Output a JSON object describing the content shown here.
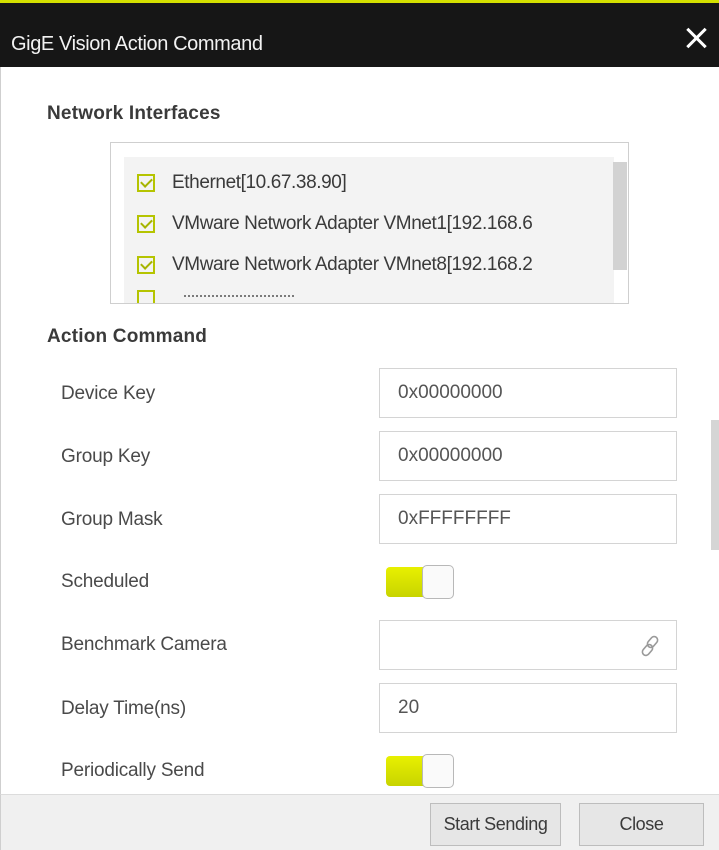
{
  "window": {
    "title": "GigE Vision Action Command",
    "accent_color": "#d4e000"
  },
  "network_interfaces": {
    "heading": "Network Interfaces",
    "items": [
      {
        "label": "Ethernet[10.67.38.90]",
        "checked": true
      },
      {
        "label": "VMware Network Adapter VMnet1[192.168.6",
        "checked": true
      },
      {
        "label": "VMware Network Adapter VMnet8[192.168.2",
        "checked": true
      },
      {
        "label": "",
        "checked": true
      }
    ]
  },
  "action_command": {
    "heading": "Action Command",
    "device_key": {
      "label": "Device Key",
      "value": "0x00000000"
    },
    "group_key": {
      "label": "Group Key",
      "value": "0x00000000"
    },
    "group_mask": {
      "label": "Group Mask",
      "value": "0xFFFFFFFF"
    },
    "scheduled": {
      "label": "Scheduled",
      "on": true
    },
    "benchmark_camera": {
      "label": "Benchmark Camera",
      "value": "",
      "icon": "link-icon"
    },
    "delay_time": {
      "label": "Delay Time(ns)",
      "value": "20"
    },
    "periodically_send": {
      "label": "Periodically Send",
      "on": true
    }
  },
  "footer": {
    "start_label": "Start Sending",
    "close_label": "Close"
  }
}
